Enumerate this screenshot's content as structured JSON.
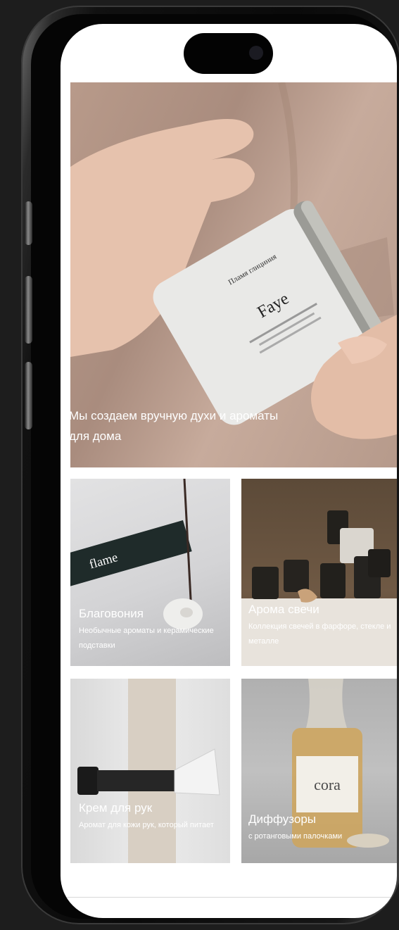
{
  "hero": {
    "title": "Мы создаем вручную духи и ароматы для дома",
    "product_label_brand": "Пламя глициния",
    "product_label_name": "Faye"
  },
  "categories": [
    {
      "title": "Благовония",
      "subtitle": "Необычные ароматы и керамические подставки",
      "brand_mark": "flame"
    },
    {
      "title": "Арома свечи",
      "subtitle": "Коллекция свечей в фарфоре, стекле и металле"
    },
    {
      "title": "Крем для рук",
      "subtitle": "Аромат для кожи рук, который питает"
    },
    {
      "title": "Диффузоры",
      "subtitle": "с ротанговыми палочками",
      "bottle_label": "cora"
    }
  ]
}
